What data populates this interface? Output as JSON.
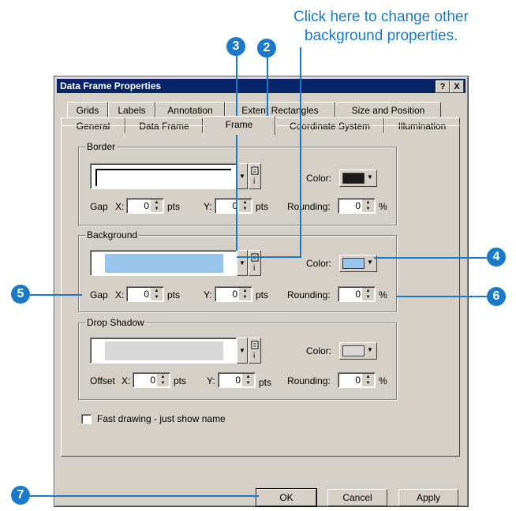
{
  "callout": {
    "line1": "Click here to change other",
    "line2": "background properties."
  },
  "badges": {
    "b2": "2",
    "b3": "3",
    "b4": "4",
    "b5": "5",
    "b6": "6",
    "b7": "7"
  },
  "dialog": {
    "title": "Data Frame Properties",
    "help_btn": "?",
    "close_btn": "X",
    "tabs_row1": [
      "Grids",
      "Labels",
      "Annotation",
      "Extent Rectangles",
      "Size and Position"
    ],
    "tabs_row2": [
      "General",
      "Data Frame",
      "Frame",
      "Coordinate System",
      "Illumination"
    ],
    "active_tab": "Frame"
  },
  "border": {
    "legend": "Border",
    "color_label": "Color:",
    "color": "#1a1a1a",
    "gap_label": "Gap",
    "x_label": "X:",
    "x_value": "0",
    "x_unit": "pts",
    "y_label": "Y:",
    "y_value": "0",
    "y_unit": "pts",
    "rounding_label": "Rounding:",
    "rounding_value": "0",
    "rounding_unit": "%"
  },
  "background": {
    "legend": "Background",
    "color_label": "Color:",
    "color": "#97c4ea",
    "gap_label": "Gap",
    "x_label": "X:",
    "x_value": "0",
    "x_unit": "pts",
    "y_label": "Y:",
    "y_value": "0",
    "y_unit": "pts",
    "rounding_label": "Rounding:",
    "rounding_value": "0",
    "rounding_unit": "%"
  },
  "shadow": {
    "legend": "Drop Shadow",
    "color_label": "Color:",
    "color": "#d8d8d8",
    "offset_label": "Offset",
    "x_label": "X:",
    "x_value": "0",
    "x_unit": "pts",
    "y_label": "Y:",
    "y_value": "0",
    "y_unit": "pts",
    "rounding_label": "Rounding:",
    "rounding_value": "0",
    "rounding_unit": "%"
  },
  "fast_drawing": {
    "label": "Fast drawing - just show name",
    "checked": false
  },
  "buttons": {
    "ok": "OK",
    "cancel": "Cancel",
    "apply": "Apply"
  }
}
